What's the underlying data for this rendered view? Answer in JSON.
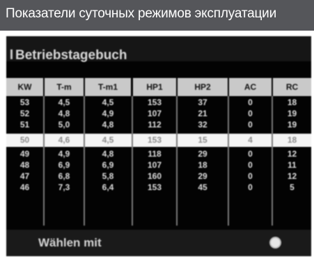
{
  "window": {
    "title": "Показатели суточных режимов эксплуатации"
  },
  "screen": {
    "header_label": "Betriebstagebuch",
    "columns": [
      "KW",
      "T-m",
      "T-m1",
      "HP1",
      "HP2",
      "AC",
      "RC"
    ],
    "rows": [
      [
        "53",
        "4,5",
        "4,5",
        "153",
        "37",
        "0",
        "18"
      ],
      [
        "52",
        "4,8",
        "4,9",
        "107",
        "21",
        "0",
        "19"
      ],
      [
        "51",
        "5,0",
        "4,8",
        "112",
        "32",
        "0",
        "19"
      ],
      [
        "50",
        "4,6",
        "4,5",
        "153",
        "15",
        "4",
        "18"
      ],
      [
        "49",
        "4,9",
        "4,8",
        "118",
        "29",
        "0",
        "12"
      ],
      [
        "48",
        "6,9",
        "6,9",
        "107",
        "18",
        "0",
        "11"
      ],
      [
        "47",
        "6,8",
        "5,8",
        "160",
        "29",
        "0",
        "12"
      ],
      [
        "46",
        "7,3",
        "6,4",
        "153",
        "45",
        "0",
        "5"
      ]
    ],
    "selected_row_index": 3,
    "footer_label": "Wählen mit",
    "footer_icon": "rotary-knob-icon"
  }
}
